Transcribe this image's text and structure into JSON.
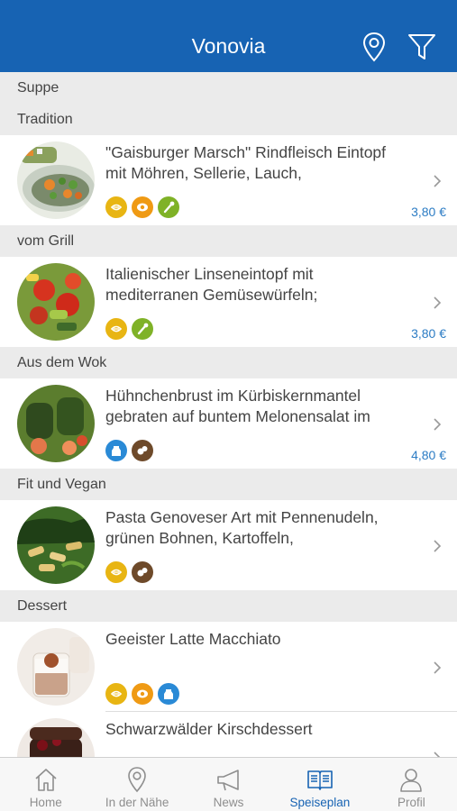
{
  "header": {
    "title": "Vonovia"
  },
  "menu": {
    "top_section": "Suppe",
    "categories": [
      {
        "name": "Tradition",
        "item": {
          "description": "\"Gaisburger Marsch\" Rindfleisch Eintopf mit Möhren, Sellerie, Lauch,",
          "price": "3,80 €",
          "icons": [
            "wheat-icon",
            "egg-icon",
            "celery-icon"
          ]
        }
      },
      {
        "name": "vom Grill",
        "item": {
          "description": "Italienischer Linseneintopf mit mediterranen Gemüsewürfeln;",
          "price": "3,80 €",
          "icons": [
            "wheat-icon",
            "celery-icon"
          ]
        }
      },
      {
        "name": "Aus dem Wok",
        "item": {
          "description": "Hühnchenbrust im Kürbiskernmantel gebraten auf buntem Melonensalat im",
          "price": "4,80 €",
          "icons": [
            "milk-icon",
            "nut-icon"
          ]
        }
      },
      {
        "name": "Fit und Vegan",
        "item": {
          "description": "Pasta Genoveser Art mit Pennenudeln, grünen Bohnen, Kartoffeln,",
          "price": "",
          "icons": [
            "wheat-icon",
            "nut-icon"
          ]
        }
      },
      {
        "name": "Dessert",
        "item": {
          "description": "Geeister Latte Macchiato",
          "price": "",
          "icons": [
            "wheat-icon",
            "egg-icon",
            "milk-icon"
          ]
        }
      }
    ],
    "extra_item": {
      "description": "Schwarzwälder Kirschdessert"
    }
  },
  "tabbar": {
    "tabs": [
      {
        "label": "Home",
        "icon": "home-icon",
        "active": false
      },
      {
        "label": "In der Nähe",
        "icon": "location-pin-icon",
        "active": false
      },
      {
        "label": "News",
        "icon": "megaphone-icon",
        "active": false
      },
      {
        "label": "Speiseplan",
        "icon": "menu-book-icon",
        "active": true
      },
      {
        "label": "Profil",
        "icon": "person-icon",
        "active": false
      }
    ]
  },
  "colors": {
    "header_bg": "#1763b3",
    "section_bg": "#ebebeb",
    "price": "#2c7cc4",
    "badge_yellow": "#e8b513",
    "badge_orange": "#ef9a14",
    "badge_green": "#7fb227",
    "badge_blue": "#2a8ad6",
    "badge_brown": "#6e4a2a",
    "tab_active": "#1763b3",
    "tab_inactive": "#8e8e8e"
  }
}
